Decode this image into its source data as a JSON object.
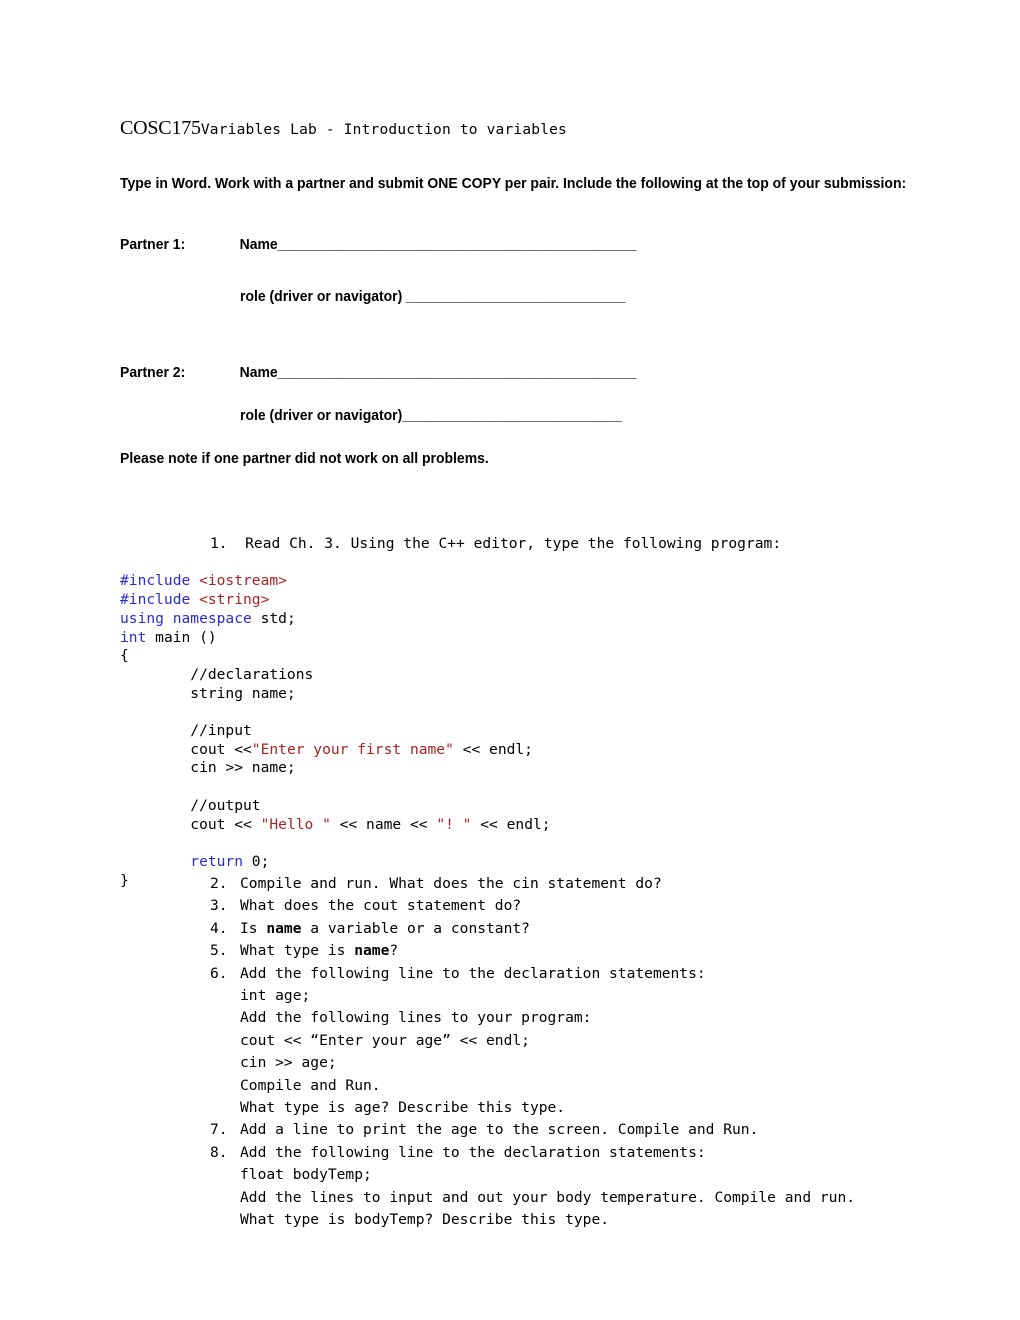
{
  "document": {
    "title": {
      "course": "COSC175",
      "rest": "Variables Lab - Introduction to variables"
    },
    "intro_paragraph": "Type in Word. Work with a partner and submit ONE COPY per pair. Include the following at the top of your submission:",
    "partner1": {
      "label": "Partner 1:",
      "name_label": "Name",
      "name_fill": "_________________________________________________",
      "role_label": "role (driver or navigator)",
      "role_fill": " ______________________________"
    },
    "partner2": {
      "label": "Partner 2:",
      "name_label": "Name",
      "name_fill": "_________________________________________________",
      "role_label": "role (driver or navigator)",
      "role_fill": "______________________________"
    },
    "note": "Please note if one partner did not work on all problems.",
    "item1_text": "1.  Read Ch. 3. Using the C++ editor, type the following program:",
    "code": {
      "line1_kw": "#include ",
      "line1_str": "<iostream>",
      "line2_kw": "#include ",
      "line2_str": "<string>",
      "line3_kw": "using namespace ",
      "line3_plain": "std;",
      "line4_kw": "int ",
      "line4_plain": "main ()",
      "line5": "{",
      "line6": "        //declarations",
      "line7": "        string name;",
      "line8_pre": "        //input\n        cout <<",
      "line8_str": "\"Enter your first name\"",
      "line8_post": " << endl;",
      "line9": "        cin >> name;",
      "line10_pre": "        //output\n        cout << ",
      "line10_str1": "\"Hello \"",
      "line10_mid": " << name << ",
      "line10_str2": "\"! \"",
      "line10_post": " << endl;",
      "line11_kw": "        return ",
      "line11_plain": "0;",
      "line12": "}"
    },
    "questions": [
      {
        "num": "2.",
        "lines": [
          "Compile and run. What does the cin statement do?"
        ]
      },
      {
        "num": "3.",
        "lines": [
          "What does the cout statement do?"
        ]
      },
      {
        "num": "4.",
        "lines": [
          "Is name a variable or a constant?"
        ],
        "bold_terms": [
          "name"
        ]
      },
      {
        "num": "5.",
        "lines": [
          "What type is name?"
        ],
        "bold_terms": [
          "name"
        ]
      },
      {
        "num": "6.",
        "lines": [
          "Add the following line to the declaration statements:",
          "int age;",
          "Add the following lines to your program:",
          "cout << “Enter your age” << endl;",
          "cin >> age;",
          "Compile and Run.",
          "What type is age? Describe this type."
        ]
      },
      {
        "num": "7.",
        "lines": [
          "Add a line to print the age to the screen. Compile and Run."
        ]
      },
      {
        "num": "8.",
        "lines": [
          "Add the following line to the declaration statements:",
          "float bodyTemp;",
          "Add the lines to input and out your body temperature. Compile and run.",
          "What type is bodyTemp? Describe this type."
        ]
      }
    ],
    "colors": {
      "keyword": "#2a2ad4",
      "string": "#a82323",
      "text": "#000000",
      "background": "#ffffff"
    }
  }
}
